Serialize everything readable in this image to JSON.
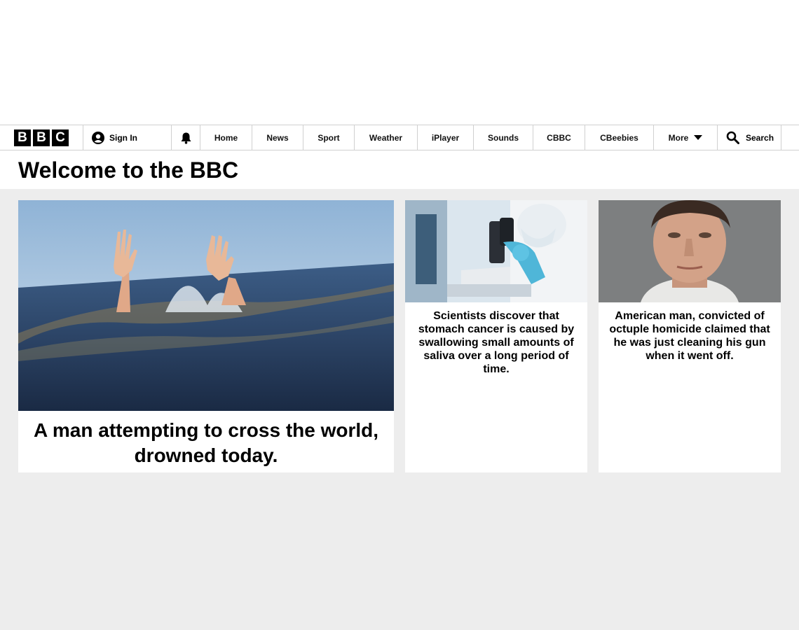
{
  "header": {
    "logo_letters": [
      "B",
      "B",
      "C"
    ],
    "sign_in_label": "Sign In",
    "nav_items": [
      {
        "label": "Home",
        "name": "nav-home"
      },
      {
        "label": "News",
        "name": "nav-news"
      },
      {
        "label": "Sport",
        "name": "nav-sport"
      },
      {
        "label": "Weather",
        "name": "nav-weather"
      },
      {
        "label": "iPlayer",
        "name": "nav-iplayer"
      },
      {
        "label": "Sounds",
        "name": "nav-sounds"
      },
      {
        "label": "CBBC",
        "name": "nav-cbbc"
      },
      {
        "label": "CBeebies",
        "name": "nav-cbeebies"
      }
    ],
    "more_label": "More",
    "search_label": "Search"
  },
  "page": {
    "title": "Welcome to the BBC"
  },
  "stories": [
    {
      "headline": "A man attempting to cross the world, drowned today.",
      "image": "drowning-hands-in-sea"
    },
    {
      "headline": "Scientists discover that stomach cancer is caused by swallowing small amounts of saliva over a long period of time.",
      "image": "scientist-with-microscope"
    },
    {
      "headline": "American man, convicted of octuple homicide claimed that he was just cleaning his gun when it went off.",
      "image": "man-mugshot"
    }
  ],
  "colors": {
    "background": "#ffffff",
    "content_background": "#ededed",
    "logo": "#000000",
    "divider": "#d0d0d0"
  }
}
